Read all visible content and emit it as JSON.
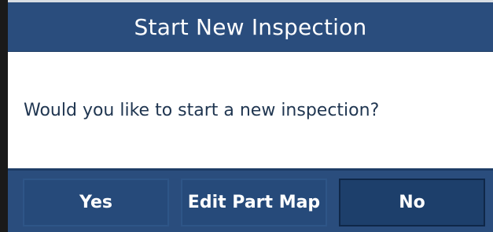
{
  "dialog": {
    "title": "Start New Inspection",
    "message": "Would you like to start a new inspection?",
    "buttons": {
      "yes_label": "Yes",
      "edit_label": "Edit Part Map",
      "no_label": "No"
    }
  },
  "colors": {
    "header": "#2a4d7d",
    "button": "#264a7a",
    "selected_button": "#1d3f6b",
    "text_dark": "#1f3550"
  }
}
